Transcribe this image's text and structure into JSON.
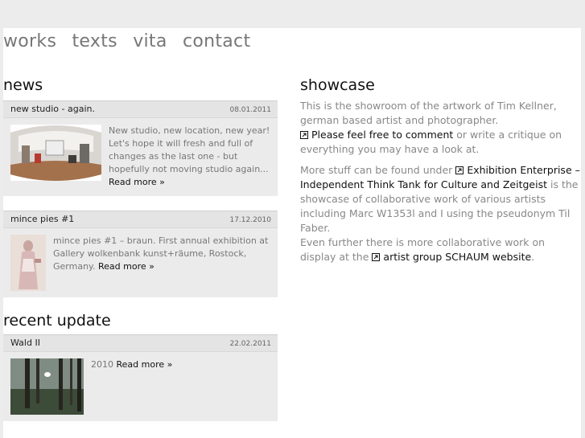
{
  "nav": {
    "items": [
      "works",
      "texts",
      "vita",
      "contact"
    ]
  },
  "news": {
    "heading": "news",
    "items": [
      {
        "title": "new studio - again.",
        "date": "08.01.2011",
        "text": "New studio, new location, new year! Let's hope it will fresh and full of changes as the last one - but hopefully not moving studio again...",
        "more": "Read more »"
      },
      {
        "title": "mince pies #1",
        "date": "17.12.2010",
        "text": "mince pies #1 – braun. First annual exhibition at Gallery wolkenbank kunst+räume, Rostock, Germany.",
        "more": "Read more »"
      }
    ]
  },
  "recent": {
    "heading": "recent update",
    "item": {
      "title": "Wald II",
      "date": "22.02.2011",
      "text": "2010",
      "more": "Read more »"
    }
  },
  "showcase": {
    "heading": "showcase",
    "p1_text": "This is the showroom of the artwork of Tim Kellner, german based artist and photographer.",
    "p1_link": "Please feel free to comment",
    "p1_tail": "or write a critique on everything you may have a look at.",
    "p2_text": "More stuff can be found under",
    "p2_link": "Exhibition Enterprise – Independent Think Tank for Culture and Zeitgeist",
    "p2_mid": "is the showcase of collaborative work of various artists including Marc W1353l and I using the pseudonym Til Faber.",
    "p2_more": "Even further there is more collaborative work on display at the",
    "p2_link2": "artist group SCHAUM website",
    "p2_end": "."
  }
}
